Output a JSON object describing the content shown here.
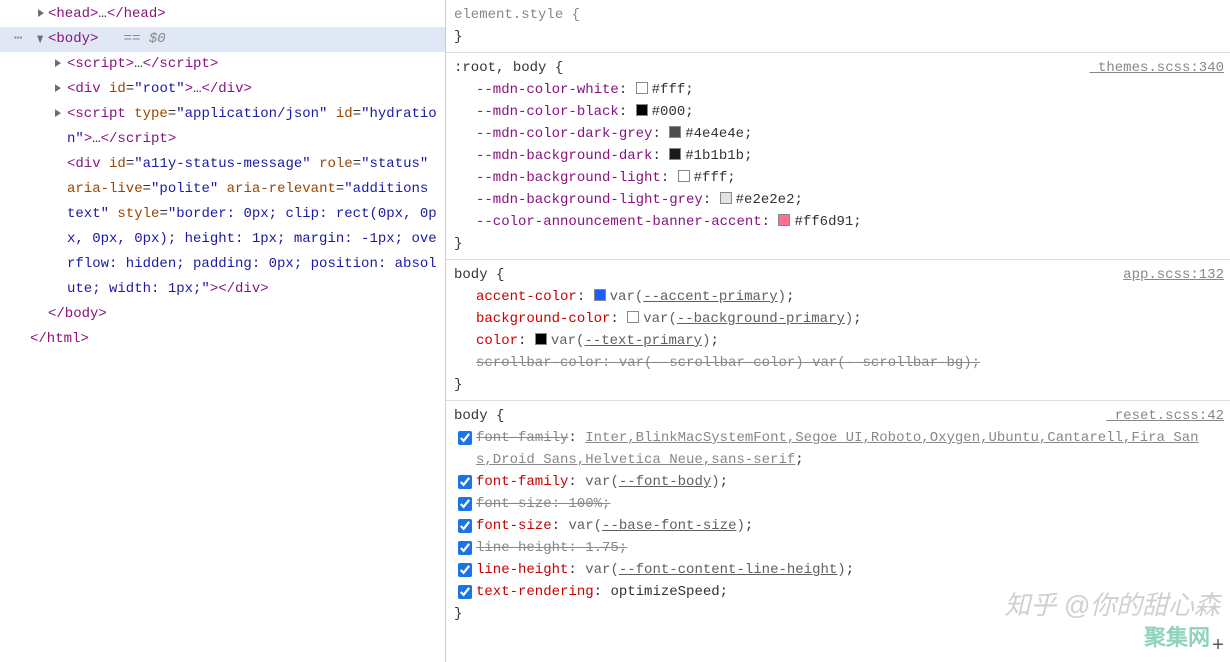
{
  "dom": {
    "head": {
      "open": "<head>",
      "ellipsis": "…",
      "close": "</head>"
    },
    "body": {
      "open": "<body>",
      "hint": "== $0"
    },
    "script1": {
      "open": "<script>",
      "ellipsis": "…",
      "close": "</script>"
    },
    "div_root": {
      "text": "<div id=\"root\">…</div>"
    },
    "script_json": {
      "line1": "<script type=\"application/json\" id=\"hy",
      "line2": "dration\">…</script>"
    },
    "div_a11y": {
      "l1": "<div id=\"a11y-status-message\" role=\"st",
      "l2": "atus\" aria-live=\"polite\" aria-",
      "l3": "relevant=\"additions text\" style=\"borde",
      "l4": "r: 0px; clip: rect(0px, 0px, 0px, 0px)",
      "l5": "; height: 1px; margin: -1px; overflow:",
      "l6": "hidden; padding: 0px; position: absolu",
      "l7": "te; width: 1px;\"></div>"
    },
    "body_close": "</body>",
    "html_close": "</html>"
  },
  "styles": {
    "element": {
      "selector": "element.style",
      "brace_open": "{",
      "brace_close": "}"
    },
    "rule2": {
      "selector_dim": ":root,",
      "selector_main": " body ",
      "brace": "{",
      "source": "_themes.scss:340",
      "props": [
        {
          "name": "--mdn-color-white",
          "swatch": "#ffffff",
          "value": "#fff"
        },
        {
          "name": "--mdn-color-black",
          "swatch": "#000000",
          "value": "#000"
        },
        {
          "name": "--mdn-color-dark-grey",
          "swatch": "#4e4e4e",
          "value": "#4e4e4e"
        },
        {
          "name": "--mdn-background-dark",
          "swatch": "#1b1b1b",
          "value": "#1b1b1b"
        },
        {
          "name": "--mdn-background-light",
          "swatch": "#ffffff",
          "value": "#fff"
        },
        {
          "name": "--mdn-background-light-grey",
          "swatch": "#e2e2e2",
          "value": "#e2e2e2"
        },
        {
          "name": "--color-announcement-banner-accent",
          "swatch": "#ff6d91",
          "value": "#ff6d91"
        }
      ],
      "brace_close": "}"
    },
    "rule3": {
      "selector": "body ",
      "brace": "{",
      "source": "app.scss:132",
      "props": [
        {
          "name": "accent-color",
          "swatch": "#1a5fff",
          "var": "--accent-primary"
        },
        {
          "name": "background-color",
          "swatch": "#ffffff",
          "var": "--background-primary"
        },
        {
          "name": "color",
          "swatch": "#000000",
          "var": "--text-primary"
        }
      ],
      "strike": {
        "name": "scrollbar-color",
        "text": "var(--scrollbar-color) var(--scrollbar-bg);"
      },
      "brace_close": "}"
    },
    "rule4": {
      "selector": "body ",
      "brace": "{",
      "source": "_reset.scss:42",
      "props": [
        {
          "name": "font-family",
          "strike": true,
          "value": "Inter,BlinkMacSystemFont,Segoe UI,Roboto,Oxygen,Ubuntu,Cantarell,Fira Sans,Droid Sans,Helvetica Neue,sans-serif"
        },
        {
          "name": "font-family",
          "var": "--font-body"
        },
        {
          "name": "font-size",
          "strike": true,
          "value": "100%"
        },
        {
          "name": "font-size",
          "var": "--base-font-size"
        },
        {
          "name": "line-height",
          "strike": true,
          "value": "1.75"
        },
        {
          "name": "line-height",
          "var": "--font-content-line-height"
        },
        {
          "name": "text-rendering",
          "value": "optimizeSpeed"
        }
      ],
      "brace_close": "}"
    }
  },
  "watermark1": "知乎 @你的甜心森",
  "watermark2": "聚集网"
}
